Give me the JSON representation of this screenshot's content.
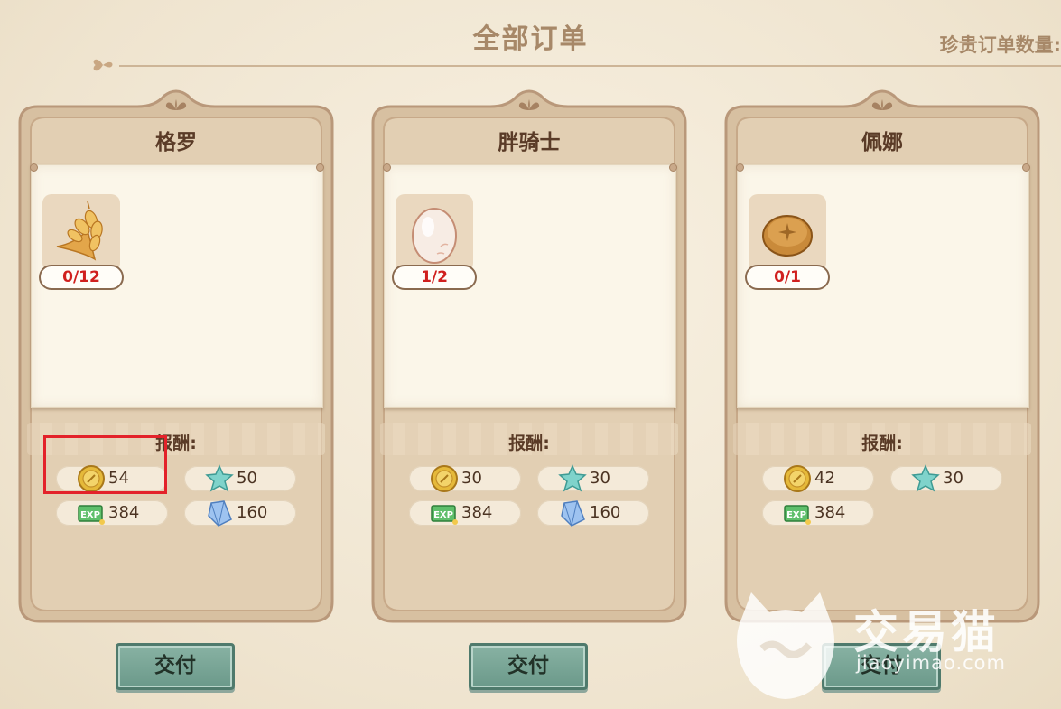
{
  "header": {
    "title": "全部订单",
    "precious_label": "珍贵订单数量:"
  },
  "reward_label": "报酬:",
  "deliver_label": "交付",
  "colors": {
    "count_text": "#d0201e",
    "deliver_button": "#7aa696",
    "card_frame": "#dcc6a8",
    "highlight": "#e3222a"
  },
  "orders": [
    {
      "name": "格罗",
      "item": {
        "icon": "wheat-icon",
        "count": "0/12"
      },
      "rewards": [
        {
          "icon": "gold-coin-icon",
          "value": "54"
        },
        {
          "icon": "star-icon",
          "value": "50"
        },
        {
          "icon": "exp-ticket-icon",
          "value": "384"
        },
        {
          "icon": "crystal-icon",
          "value": "160"
        }
      ]
    },
    {
      "name": "胖骑士",
      "item": {
        "icon": "egg-icon",
        "count": "1/2"
      },
      "rewards": [
        {
          "icon": "gold-coin-icon",
          "value": "30"
        },
        {
          "icon": "star-icon",
          "value": "30"
        },
        {
          "icon": "exp-ticket-icon",
          "value": "384"
        },
        {
          "icon": "crystal-icon",
          "value": "160"
        }
      ]
    },
    {
      "name": "佩娜",
      "item": {
        "icon": "bread-icon",
        "count": "0/1"
      },
      "rewards": [
        {
          "icon": "gold-coin-icon",
          "value": "42"
        },
        {
          "icon": "star-icon",
          "value": "30"
        },
        {
          "icon": "exp-ticket-icon",
          "value": "384"
        }
      ]
    }
  ],
  "watermark": {
    "text": "交易猫",
    "url": "jiaoyimao.com"
  }
}
